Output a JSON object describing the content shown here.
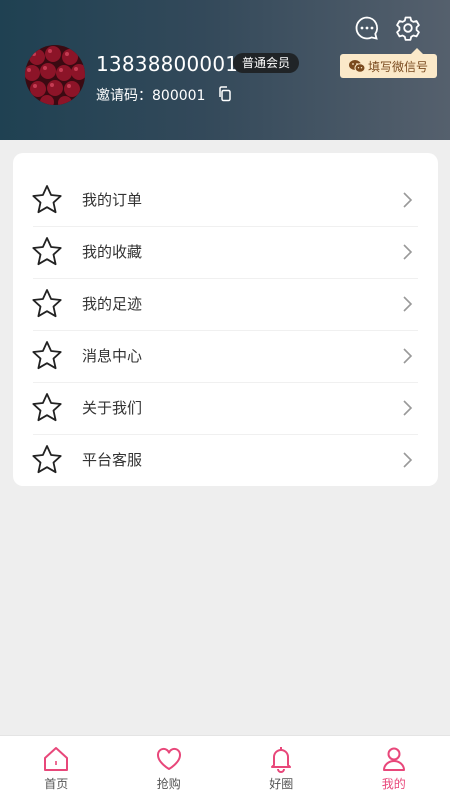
{
  "profile": {
    "phone": "13838800001",
    "member_badge": "普通会员",
    "invite_code_text": "邀请码：800001",
    "wechat_button": "填写微信号"
  },
  "header_icons": [
    "message-icon",
    "settings-icon"
  ],
  "menu": [
    {
      "label": "我的订单",
      "icon": "star-icon"
    },
    {
      "label": "我的收藏",
      "icon": "star-icon"
    },
    {
      "label": "我的足迹",
      "icon": "star-icon"
    },
    {
      "label": "消息中心",
      "icon": "star-icon"
    },
    {
      "label": "关于我们",
      "icon": "star-icon"
    },
    {
      "label": "平台客服",
      "icon": "star-icon"
    }
  ],
  "tabbar": {
    "active": "我的",
    "accent_color": "#e8477a",
    "tabs": [
      {
        "label": "首页",
        "icon": "home-icon"
      },
      {
        "label": "抢购",
        "icon": "heart-icon"
      },
      {
        "label": "好圈",
        "icon": "bell-icon"
      },
      {
        "label": "我的",
        "icon": "user-icon"
      }
    ]
  }
}
